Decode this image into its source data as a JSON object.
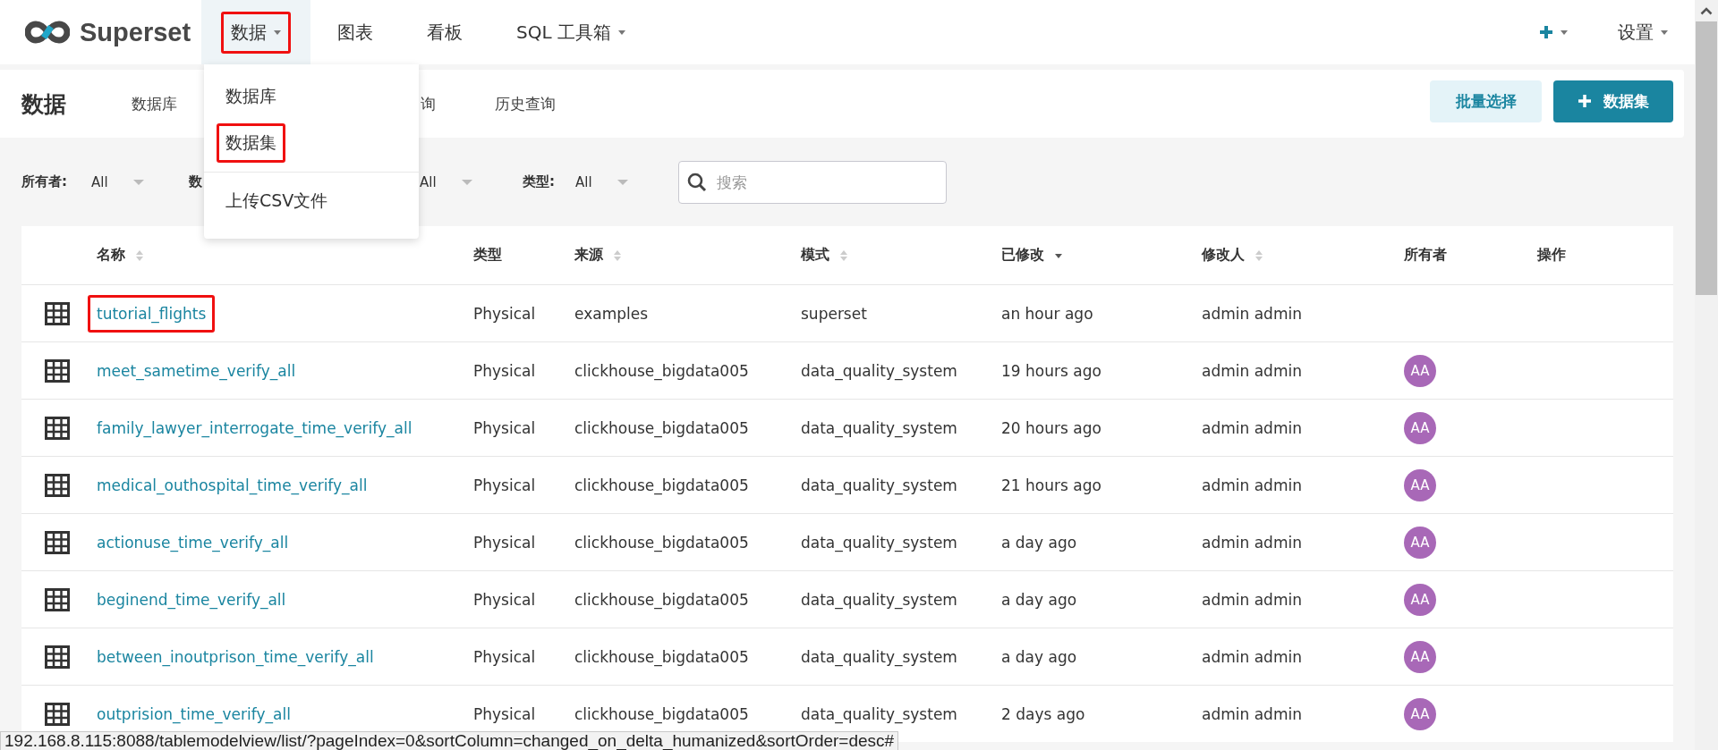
{
  "header": {
    "brand": "Superset",
    "nav": [
      {
        "label": "数据",
        "has_menu": true,
        "selected": true,
        "highlighted": true
      },
      {
        "label": "图表",
        "has_menu": false,
        "selected": false,
        "highlighted": false
      },
      {
        "label": "看板",
        "has_menu": false,
        "selected": false,
        "highlighted": false
      },
      {
        "label": "SQL 工具箱",
        "has_menu": true,
        "selected": false,
        "highlighted": false
      }
    ],
    "right_nav": [
      {
        "kind": "plus",
        "has_menu": true
      },
      {
        "kind": "text",
        "label": "设置",
        "has_menu": true
      }
    ]
  },
  "dropdown": {
    "items": [
      {
        "kind": "item",
        "label": "数据库",
        "highlighted": false
      },
      {
        "kind": "item",
        "label": "数据集",
        "highlighted": true
      },
      {
        "kind": "divider"
      },
      {
        "kind": "item",
        "label": "上传CSV文件",
        "highlighted": false
      }
    ]
  },
  "subheader": {
    "title": "数据",
    "tabs": [
      {
        "label": "数据库",
        "selected": false
      },
      {
        "label": "询",
        "selected": false
      },
      {
        "label": "历史查询",
        "selected": false
      }
    ],
    "buttons": [
      {
        "kind": "secondary",
        "label": "批量选择"
      },
      {
        "kind": "primary",
        "label": "数据集"
      }
    ]
  },
  "filters": [
    {
      "label": "所有者:",
      "value": "All"
    },
    {
      "label": "数",
      "value": "All"
    },
    {
      "label": "类型:",
      "value": "All"
    }
  ],
  "search": {
    "placeholder": "搜索"
  },
  "table": {
    "columns": [
      {
        "label": "名称",
        "sortable": true,
        "sorted_desc": false
      },
      {
        "label": "类型",
        "sortable": false
      },
      {
        "label": "来源",
        "sortable": true,
        "sorted_desc": false
      },
      {
        "label": "模式",
        "sortable": true,
        "sorted_desc": false
      },
      {
        "label": "已修改",
        "sortable": true,
        "sorted_desc": true
      },
      {
        "label": "修改人",
        "sortable": true,
        "sorted_desc": false
      },
      {
        "label": "所有者",
        "sortable": false
      },
      {
        "label": "操作",
        "sortable": false
      }
    ],
    "rows": [
      {
        "name": "tutorial_flights",
        "highlighted": true,
        "type": "Physical",
        "source": "examples",
        "schema": "superset",
        "modified": "an hour ago",
        "modified_by": "admin admin"
      },
      {
        "name": "meet_sametime_verify_all",
        "highlighted": false,
        "type": "Physical",
        "source": "clickhouse_bigdata005",
        "schema": "data_quality_system",
        "modified": "19 hours ago",
        "modified_by": "admin admin",
        "owner": "AA"
      },
      {
        "name": "family_lawyer_interrogate_time_verify_all",
        "highlighted": false,
        "type": "Physical",
        "source": "clickhouse_bigdata005",
        "schema": "data_quality_system",
        "modified": "20 hours ago",
        "modified_by": "admin admin",
        "owner": "AA"
      },
      {
        "name": "medical_outhospital_time_verify_all",
        "highlighted": false,
        "type": "Physical",
        "source": "clickhouse_bigdata005",
        "schema": "data_quality_system",
        "modified": "21 hours ago",
        "modified_by": "admin admin",
        "owner": "AA"
      },
      {
        "name": "actionuse_time_verify_all",
        "highlighted": false,
        "type": "Physical",
        "source": "clickhouse_bigdata005",
        "schema": "data_quality_system",
        "modified": "a day ago",
        "modified_by": "admin admin",
        "owner": "AA"
      },
      {
        "name": "beginend_time_verify_all",
        "highlighted": false,
        "type": "Physical",
        "source": "clickhouse_bigdata005",
        "schema": "data_quality_system",
        "modified": "a day ago",
        "modified_by": "admin admin",
        "owner": "AA"
      },
      {
        "name": "between_inoutprison_time_verify_all",
        "highlighted": false,
        "type": "Physical",
        "source": "clickhouse_bigdata005",
        "schema": "data_quality_system",
        "modified": "a day ago",
        "modified_by": "admin admin",
        "owner": "AA"
      },
      {
        "name": "outprision_time_verify_all",
        "highlighted": false,
        "type": "Physical",
        "source": "clickhouse_bigdata005",
        "schema": "data_quality_system",
        "modified": "2 days ago",
        "modified_by": "admin admin",
        "owner": "AA"
      }
    ]
  },
  "status_bar": {
    "url": "192.168.8.115:8088/tablemodelview/list/?pageIndex=0&sortColumn=changed_on_delta_humanized&sortOrder=desc#"
  }
}
